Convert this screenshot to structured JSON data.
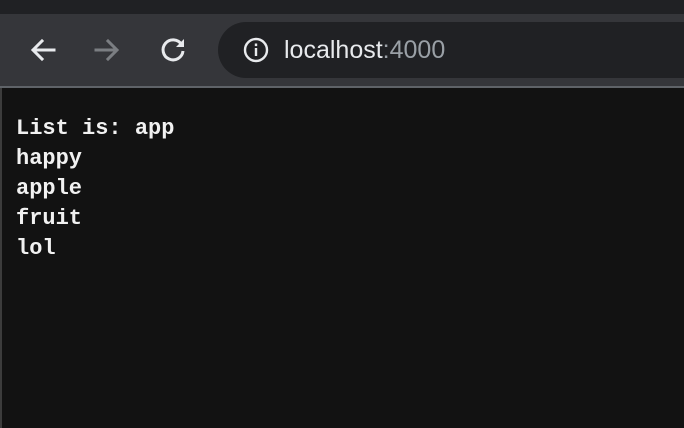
{
  "browser": {
    "address_host": "localhost",
    "address_port": ":4000"
  },
  "page": {
    "lines": [
      "List is: app",
      "happy",
      "apple",
      "fruit",
      "lol"
    ]
  },
  "icons": {
    "back": "back-arrow-icon",
    "forward": "forward-arrow-icon",
    "reload": "reload-icon",
    "info": "info-icon"
  },
  "colors": {
    "page_background": "#121212",
    "toolbar": "#35363a",
    "omnibox": "#202124",
    "text": "#f1f1f1",
    "disabled_icon": "#7b7e82"
  }
}
